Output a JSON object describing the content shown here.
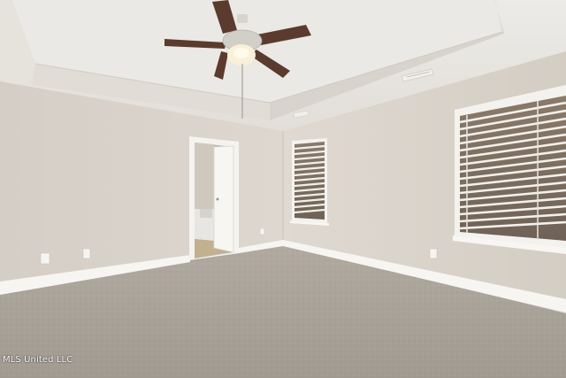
{
  "photo": {
    "subject": "empty-bedroom-with-carpet-and-ceiling-fan",
    "watermark": "MLS United LLC"
  },
  "palette": {
    "wall": "#dcd6cd",
    "ceiling": "#ebe7e2",
    "carpet": "#a7a198",
    "trim": "#f6f5f2",
    "fan_blade": "#5b3b2e"
  }
}
